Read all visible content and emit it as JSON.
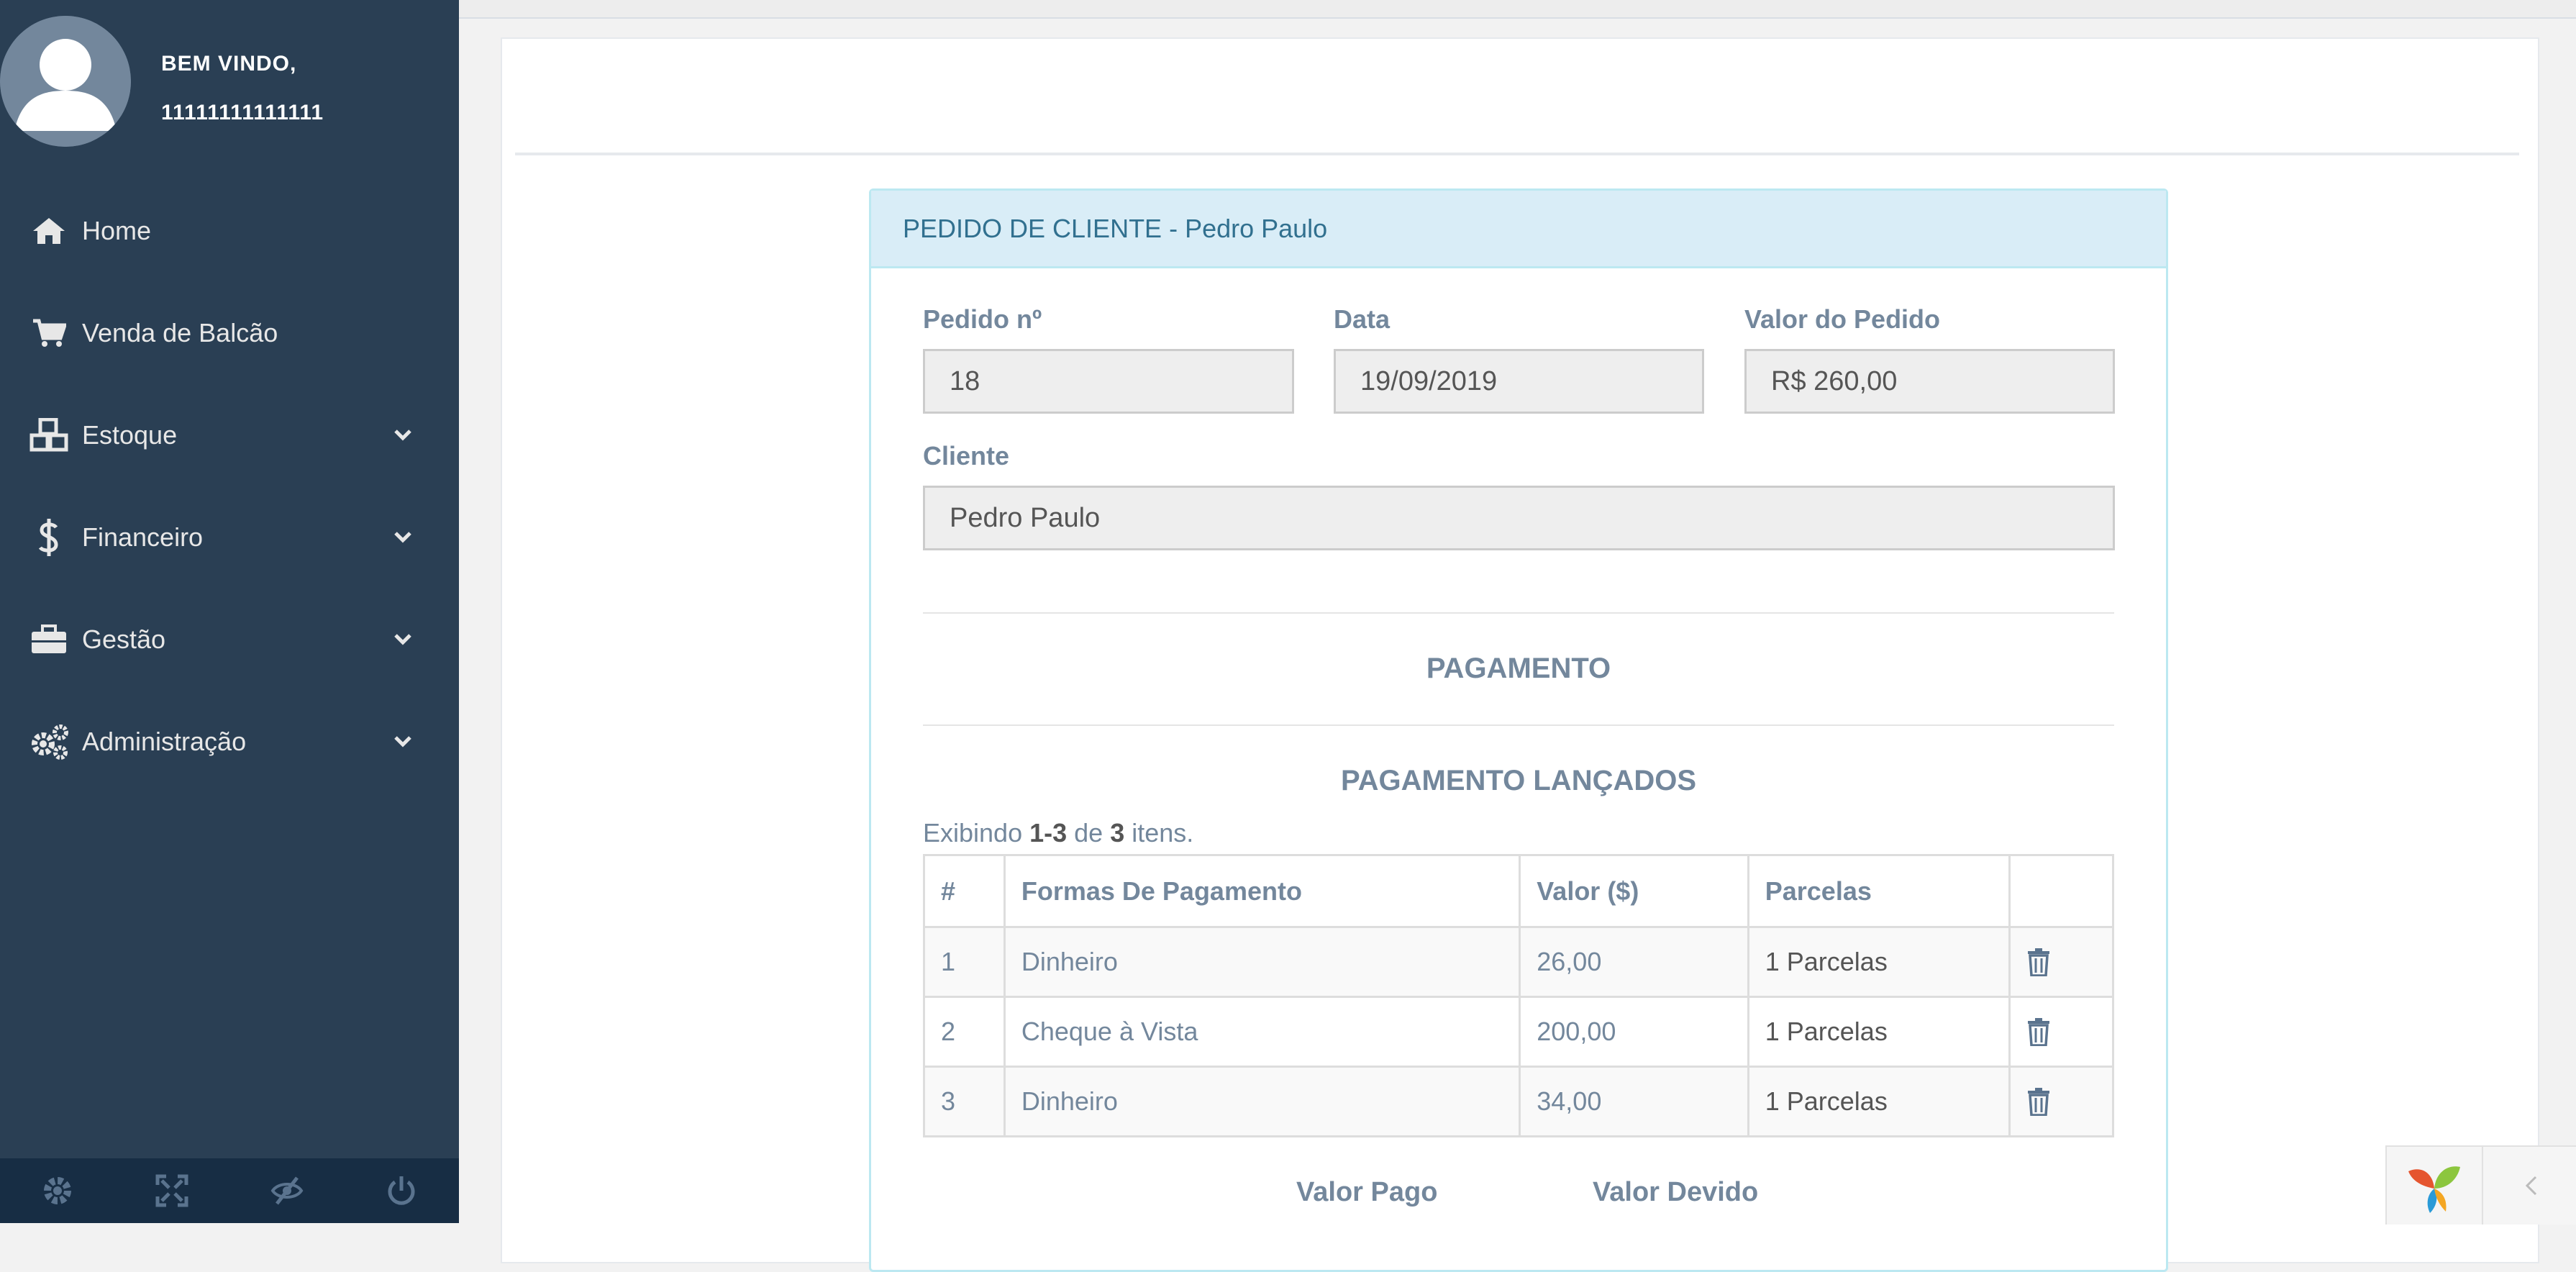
{
  "user": {
    "welcome": "BEM VINDO,",
    "name": "11111111111111"
  },
  "sidebar": {
    "items": [
      {
        "label": "Home",
        "icon": "home-icon",
        "has_submenu": false
      },
      {
        "label": "Venda de Balcão",
        "icon": "cart-icon",
        "has_submenu": false
      },
      {
        "label": "Estoque",
        "icon": "cubes-icon",
        "has_submenu": true
      },
      {
        "label": "Financeiro",
        "icon": "dollar-icon",
        "has_submenu": true
      },
      {
        "label": "Gestão",
        "icon": "briefcase-icon",
        "has_submenu": true
      },
      {
        "label": "Administração",
        "icon": "gears-icon",
        "has_submenu": true
      }
    ],
    "footer_icons": [
      "settings-icon",
      "fullscreen-icon",
      "eye-slash-icon",
      "power-icon"
    ]
  },
  "card": {
    "heading": "PEDIDO DE CLIENTE - Pedro Paulo",
    "fields": {
      "pedido_label": "Pedido nº",
      "pedido_value": "18",
      "data_label": "Data",
      "data_value": "19/09/2019",
      "valor_label": "Valor do Pedido",
      "valor_value": "R$ 260,00",
      "cliente_label": "Cliente",
      "cliente_value": "Pedro Paulo"
    },
    "pagamento_title": "PAGAMENTO",
    "lancados_title": "PAGAMENTO LANÇADOS",
    "summary": {
      "prefix": "Exibindo",
      "range": "1-3",
      "middle": "de",
      "total": "3",
      "suffix": "itens."
    },
    "table": {
      "headers": [
        "#",
        "Formas De Pagamento",
        "Valor ($)",
        "Parcelas",
        ""
      ],
      "rows": [
        {
          "n": "1",
          "forma": "Dinheiro",
          "valor": "26,00",
          "parcelas": "1 Parcelas"
        },
        {
          "n": "2",
          "forma": "Cheque à Vista",
          "valor": "200,00",
          "parcelas": "1 Parcelas"
        },
        {
          "n": "3",
          "forma": "Dinheiro",
          "valor": "34,00",
          "parcelas": "1 Parcelas"
        }
      ]
    },
    "totals": {
      "pago_label": "Valor Pago",
      "devido_label": "Valor Devido"
    }
  },
  "colors": {
    "sidebar_bg": "#2a3f54",
    "sidebar_footer_bg": "#172d44",
    "card_heading_bg": "#d9edf7",
    "card_heading_text": "#31708f",
    "muted_text": "#73879c"
  }
}
